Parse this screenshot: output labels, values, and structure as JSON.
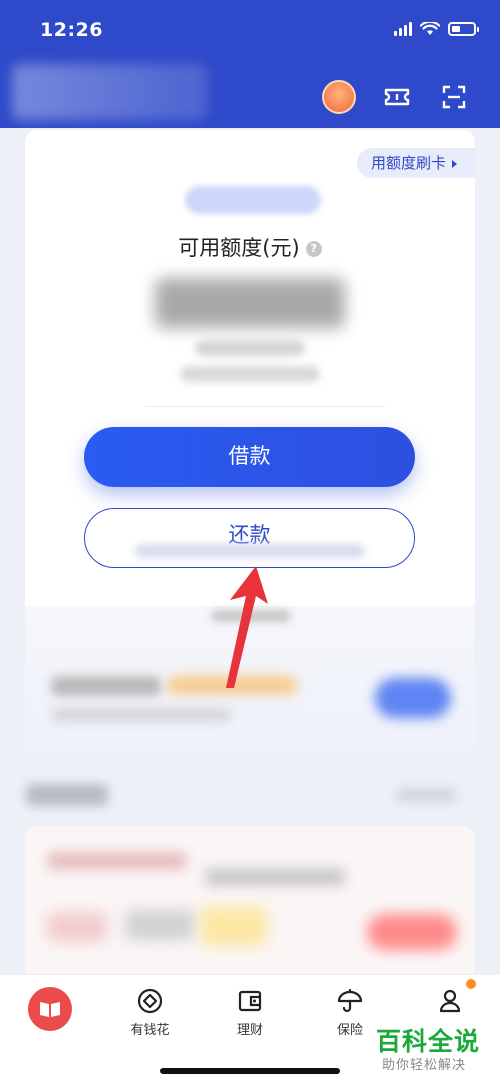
{
  "status_bar": {
    "time": "12:26"
  },
  "header": {
    "icons": [
      "avatar",
      "ticket-icon",
      "scan-icon"
    ]
  },
  "credit_card": {
    "quota_tag": "用额度刷卡",
    "available_label": "可用额度(元)",
    "help_glyph": "?",
    "borrow_button": "借款",
    "repay_button": "还款"
  },
  "tabbar": {
    "items": [
      {
        "label": "",
        "icon": "home-book-icon"
      },
      {
        "label": "有钱花",
        "icon": "diamond-circle-icon"
      },
      {
        "label": "理财",
        "icon": "wallet-icon"
      },
      {
        "label": "保险",
        "icon": "umbrella-icon"
      },
      {
        "label": "",
        "icon": "user-icon"
      }
    ]
  },
  "watermark": {
    "main": "百科全说",
    "sub": "助你轻松解决"
  },
  "colors": {
    "header_blue": "#2e49c9",
    "button_blue": "#2a5cf2",
    "annotation_red": "#e8333a",
    "watermark_green": "#1ca83a"
  }
}
